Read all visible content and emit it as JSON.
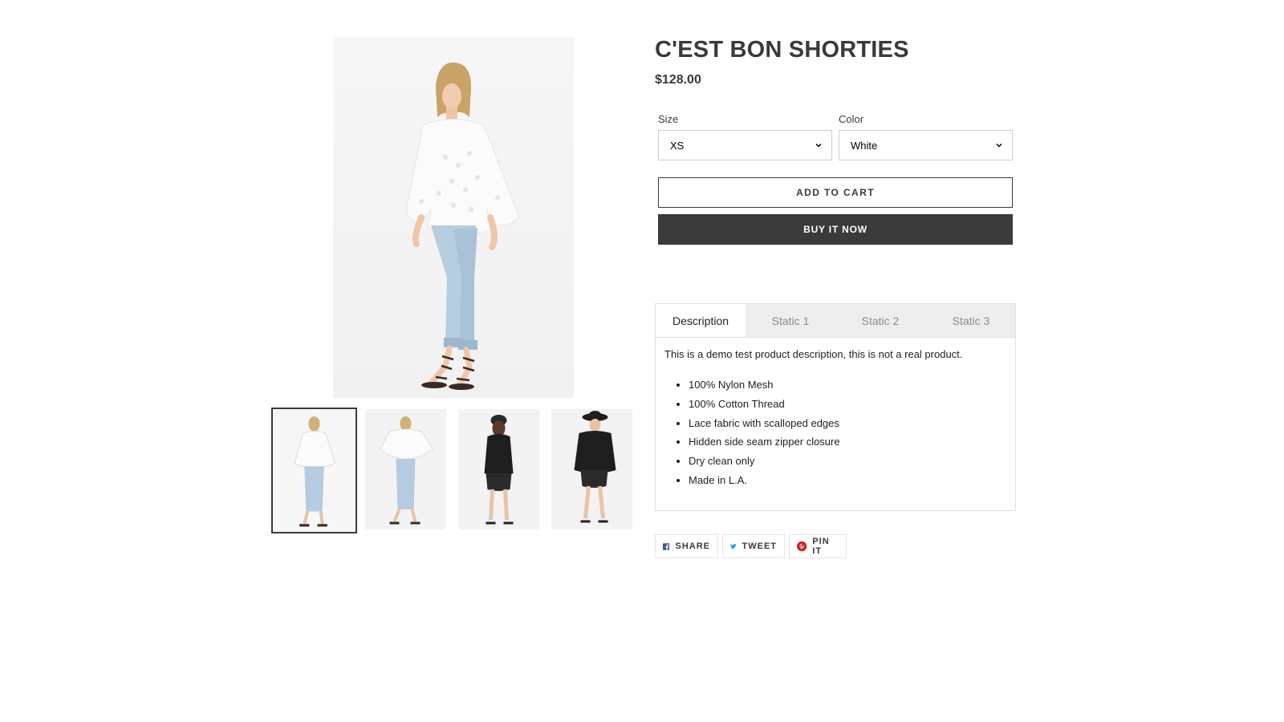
{
  "product": {
    "title": "C'EST BON SHORTIES",
    "price": "$128.00"
  },
  "options": {
    "size": {
      "label": "Size",
      "selected": "XS"
    },
    "color": {
      "label": "Color",
      "selected": "White"
    }
  },
  "buttons": {
    "add_to_cart": "ADD TO CART",
    "buy_now": "BUY IT NOW"
  },
  "tabs": [
    {
      "label": "Description",
      "active": true
    },
    {
      "label": "Static 1",
      "active": false
    },
    {
      "label": "Static 2",
      "active": false
    },
    {
      "label": "Static 3",
      "active": false
    }
  ],
  "description": {
    "intro": "This is a demo test product description, this is not a real product.",
    "bullets": [
      "100% Nylon Mesh",
      "100% Cotton Thread",
      "Lace fabric with scalloped edges",
      "Hidden side seam zipper closure",
      "Dry clean only",
      "Made in L.A."
    ]
  },
  "share": {
    "facebook": "SHARE",
    "twitter": "TWEET",
    "pinterest": "PIN IT"
  },
  "colors": {
    "text": "#3a3a3a",
    "buy_button_bg": "#3a3a3a",
    "tab_bar_bg": "#eeeeee",
    "facebook": "#3b5998",
    "twitter": "#1da1f2",
    "pinterest": "#cb2027"
  },
  "gallery": {
    "thumbnail_count": 4,
    "active_thumbnail": 1
  }
}
